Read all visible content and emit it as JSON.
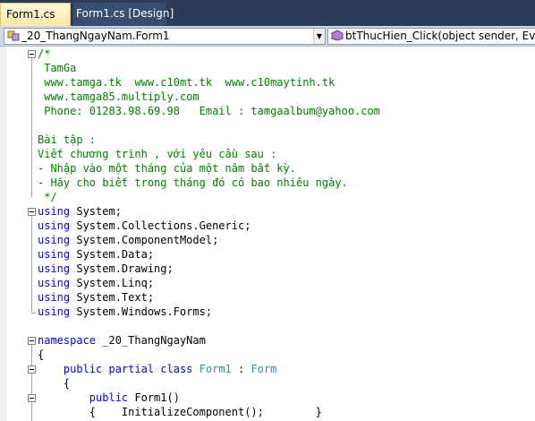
{
  "tabs": [
    {
      "label": "Form1.cs",
      "close": "×"
    },
    {
      "label": "Form1.cs [Design]"
    }
  ],
  "navbar": {
    "type_combo": "_20_ThangNgayNam.Form1",
    "member_combo": "btThucHien_Click(object sender, EventAr",
    "arrow": "▼"
  },
  "code": {
    "header_comment": [
      "/*",
      " TamGa",
      " www.tamga.tk  www.c10mt.tk  www.c10maytinh.tk",
      " www.tamga85.multiply.com",
      " Phone: 01283.98.69.98   Email : tamgaalbum@yahoo.com",
      "",
      "Bài tập :",
      "Viết chương trình , với yêu cầu sau :",
      "- Nhập vào một tháng của một năm bất kỳ.",
      "- Hãy cho biết trong tháng đó có bao nhiêu ngày.",
      " */"
    ],
    "using_keyword": "using",
    "usings": [
      "System;",
      "System.Collections.Generic;",
      "System.ComponentModel;",
      "System.Data;",
      "System.Drawing;",
      "System.Linq;",
      "System.Text;",
      "System.Windows.Forms;"
    ],
    "namespace_keyword": "namespace",
    "namespace_name": " _20_ThangNgayNam",
    "open_brace": "{",
    "class_indent": "    ",
    "class_keywords": "public partial class",
    "class_name": "Form1",
    "colon": " : ",
    "base_class": "Form",
    "class_open": "    {",
    "ctor_indent": "        ",
    "ctor_keyword": "public",
    "ctor_name": " Form1()",
    "ctor_body": "        {    InitializeComponent();        }"
  }
}
